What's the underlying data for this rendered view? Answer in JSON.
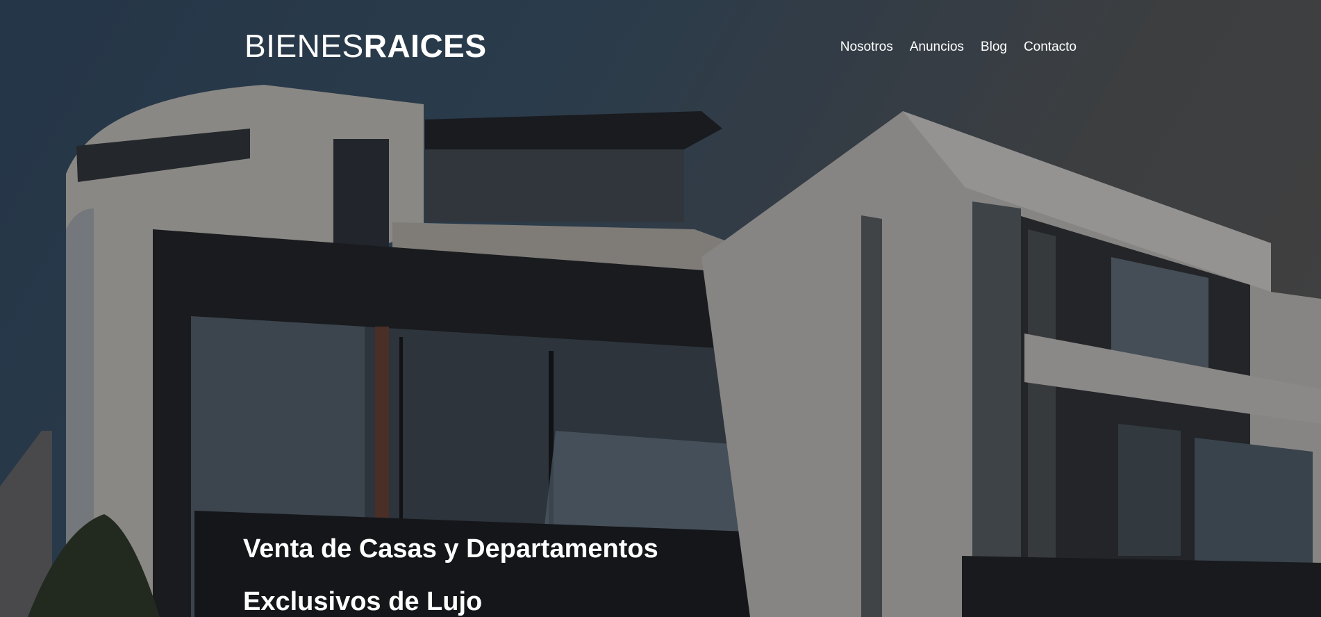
{
  "header": {
    "logo_light": "BIENES",
    "logo_bold": "RAICES",
    "nav": [
      "Nosotros",
      "Anuncios",
      "Blog",
      "Contacto"
    ]
  },
  "hero": {
    "title_line1": "Venta de Casas y Departamentos",
    "title_line2": "Exclusivos de Lujo"
  },
  "colors": {
    "text": "#ffffff",
    "sky": "#2d4257",
    "overlay": "#000000"
  }
}
